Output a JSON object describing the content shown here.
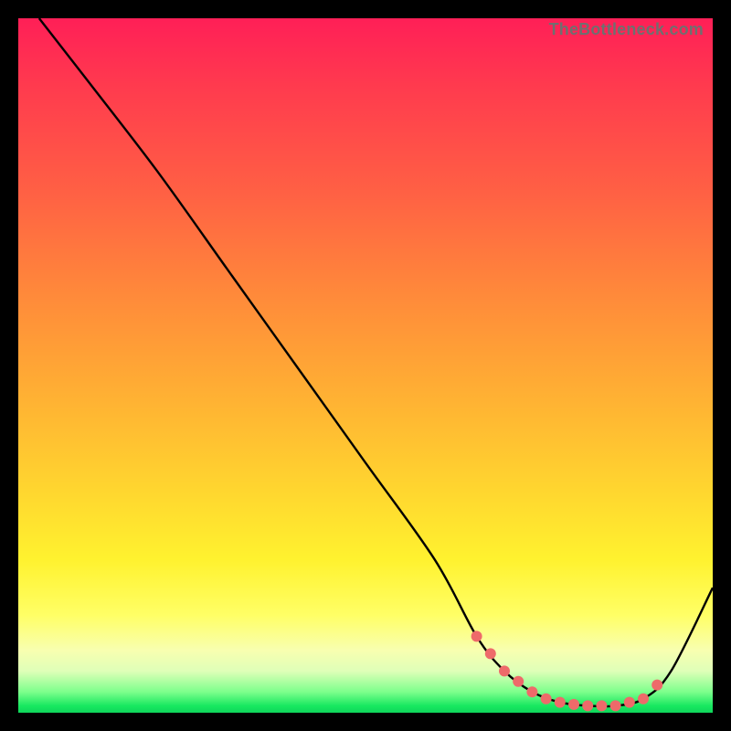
{
  "watermark": "TheBottleneck.com",
  "colors": {
    "background": "#000000",
    "curve": "#000000",
    "marker": "#ee6a6a",
    "gradient_top": "#ff1f57",
    "gradient_bottom": "#0fd65b"
  },
  "chart_data": {
    "type": "line",
    "title": "",
    "xlabel": "",
    "ylabel": "",
    "xlim": [
      0,
      100
    ],
    "ylim": [
      0,
      100
    ],
    "series": [
      {
        "name": "bottleneck-curve",
        "x": [
          3,
          10,
          20,
          30,
          40,
          50,
          60,
          66,
          70,
          74,
          78,
          82,
          86,
          90,
          94,
          100
        ],
        "values": [
          100,
          91,
          78,
          64,
          50,
          36,
          22,
          11,
          6,
          3,
          1.5,
          1,
          1,
          2,
          6,
          18
        ]
      }
    ],
    "markers": {
      "name": "floor-band",
      "x": [
        66,
        68,
        70,
        72,
        74,
        76,
        78,
        80,
        82,
        84,
        86,
        88,
        90,
        92
      ],
      "values": [
        11,
        8.5,
        6,
        4.5,
        3,
        2,
        1.5,
        1.2,
        1,
        1,
        1,
        1.5,
        2,
        4
      ]
    }
  }
}
